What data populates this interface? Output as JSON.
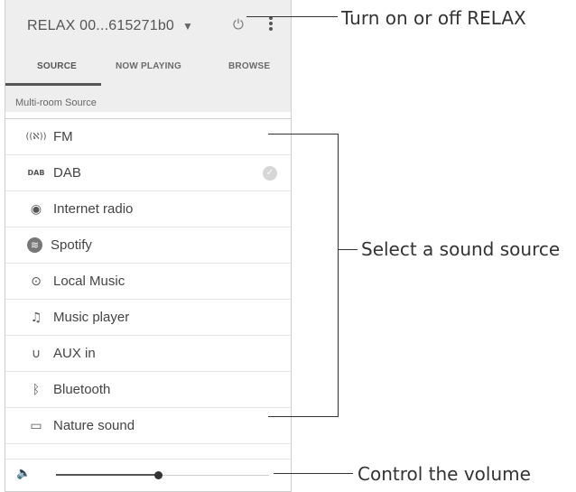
{
  "header": {
    "device_name": "RELAX 00...615271b0",
    "dropdown_glyph": "▼",
    "power_glyph": "⏻"
  },
  "tabs": [
    {
      "label": "SOURCE",
      "active": true
    },
    {
      "label": "NOW PLAYING",
      "active": false
    },
    {
      "label": "BROWSE",
      "active": false
    }
  ],
  "section_label": "Multi-room Source",
  "sources": [
    {
      "label": "FM",
      "icon": "antenna-icon",
      "glyph": "((ℵ))"
    },
    {
      "label": "DAB",
      "icon": "dab-icon",
      "glyph": "DAB",
      "selected": true
    },
    {
      "label": "Internet radio",
      "icon": "globe-icon",
      "glyph": "◉"
    },
    {
      "label": "Spotify",
      "icon": "spotify-icon",
      "glyph": "≋"
    },
    {
      "label": "Local Music",
      "icon": "local-music-icon",
      "glyph": "⊙"
    },
    {
      "label": "Music player",
      "icon": "music-note-icon",
      "glyph": "♫"
    },
    {
      "label": "AUX in",
      "icon": "aux-plug-icon",
      "glyph": "∪"
    },
    {
      "label": "Bluetooth",
      "icon": "bluetooth-icon",
      "glyph": "ᛒ"
    },
    {
      "label": "Nature sound",
      "icon": "nature-sound-icon",
      "glyph": "▭"
    }
  ],
  "volume": {
    "icon": "speaker-icon",
    "glyph": "🔈",
    "level": 0.48
  },
  "annotations": {
    "power": "Turn on or off RELAX",
    "sources": "Select a sound source",
    "volume": "Control the volume"
  },
  "colors": {
    "header_bg": "#eeeeee",
    "text": "#444444",
    "accent": "#555555"
  }
}
